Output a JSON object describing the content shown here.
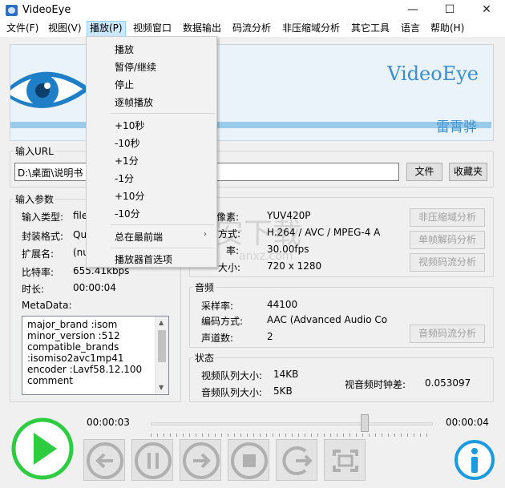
{
  "window": {
    "title": "VideoEye",
    "minimize": "—",
    "maximize": "☐",
    "close": "✕"
  },
  "menubar": [
    {
      "label": "文件(F)"
    },
    {
      "label": "视图(V)"
    },
    {
      "label": "播放(P)"
    },
    {
      "label": "视频窗口"
    },
    {
      "label": "数据输出"
    },
    {
      "label": "码流分析"
    },
    {
      "label": "非压缩域分析"
    },
    {
      "label": "其它工具"
    },
    {
      "label": "语言"
    },
    {
      "label": "帮助(H)"
    }
  ],
  "banner": {
    "logo": "VideoEye",
    "author": "雷霄骅"
  },
  "url": {
    "legend": "输入URL",
    "value": "D:\\桌面\\说明书",
    "file_button": "文件",
    "favorites_button": "收藏夹"
  },
  "input_params": {
    "legend": "输入参数",
    "rows": [
      {
        "label": "输入类型:",
        "value": "file"
      },
      {
        "label": "封装格式:",
        "value": "Qu"
      },
      {
        "label": "扩展名:",
        "value": "(nu"
      },
      {
        "label": "比特率:",
        "value": "655.41kbps"
      },
      {
        "label": "时长:",
        "value": "00:00:04"
      }
    ],
    "metadata_label": "MetaData:",
    "metadata_lines": [
      "major_brand        :isom",
      "minor_version      :512",
      "compatible_brands",
      ":isomiso2avc1mp41",
      "encoder   :Lavf58.12.100",
      "comment"
    ]
  },
  "video": {
    "rows": [
      {
        "label": "像素:",
        "value": "YUV420P"
      },
      {
        "label": "方式:",
        "value": "H.264 / AVC / MPEG-4 A"
      },
      {
        "label": "率:",
        "value": "30.00fps"
      },
      {
        "label": "大小:",
        "value": "720 x 1280"
      }
    ],
    "buttons": [
      "非压缩域分析",
      "单帧解码分析",
      "视频码流分析"
    ]
  },
  "audio": {
    "legend": "音频",
    "rows": [
      {
        "label": "采样率:",
        "value": "44100"
      },
      {
        "label": "编码方式:",
        "value": "AAC (Advanced Audio Co"
      },
      {
        "label": "声道数:",
        "value": "2"
      }
    ],
    "button": "音频码流分析"
  },
  "status": {
    "legend": "状态",
    "video_queue_label": "视频队列大小:",
    "video_queue_value": "14KB",
    "audio_queue_label": "音频队列大小:",
    "audio_queue_value": "5KB",
    "av_clock_label": "视音频时钟差:",
    "av_clock_value": "0.053097"
  },
  "playback": {
    "current_time": "00:00:03",
    "total_time": "00:00:04",
    "progress": 0.75
  },
  "dropdown": {
    "items": [
      {
        "label": "播放"
      },
      {
        "label": "暂停/继续"
      },
      {
        "label": "停止"
      },
      {
        "label": "逐帧播放"
      },
      {
        "label": "+10秒"
      },
      {
        "label": "-10秒"
      },
      {
        "label": "+1分"
      },
      {
        "label": "-1分"
      },
      {
        "label": "+10分"
      },
      {
        "label": "-10分"
      },
      {
        "label": "总在最前端"
      },
      {
        "label": "播放器首选项"
      }
    ],
    "submenu_arrow": "›"
  },
  "watermark": {
    "text": "安下载",
    "sub": "anxz.com"
  },
  "colors": {
    "accent": "#3a8fd0",
    "play_green": "#2ecc40",
    "info_blue": "#1a9be0",
    "menu_highlight": "#cce8ff"
  }
}
